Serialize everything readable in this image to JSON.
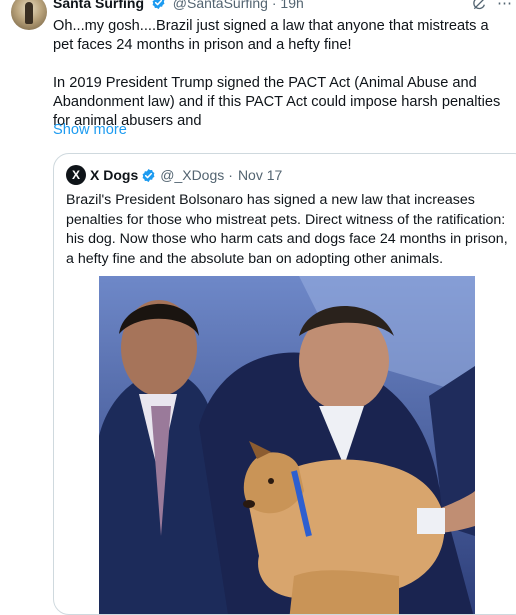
{
  "tweet": {
    "author_name": "Santa Surfing",
    "handle": "@SantaSurfing",
    "separator": "·",
    "time": "19h",
    "paragraph1": "Oh...my gosh....Brazil just signed a law that anyone that mistreats a pet faces 24 months in prison and a hefty fine!",
    "paragraph2": "In 2019 President Trump signed the PACT Act (Animal Abuse and Abandonment law) and if this PACT Act could impose harsh penalties for animal abusers and",
    "show_more": "Show more",
    "icons": [
      "grok-icon",
      "more-icon"
    ]
  },
  "quote": {
    "avatar_letter": "X",
    "author_name": "X Dogs",
    "handle": "@_XDogs",
    "separator": "·",
    "date": "Nov 17",
    "text": "Brazil's President Bolsonaro has signed a new law that increases penalties for those who mistreat pets. Direct witness of the ratification: his dog. Now those who harm cats and dogs face 24 months in prison, a hefty fine and the absolute ban on adopting other animals."
  },
  "colors": {
    "accent": "#1d9bf0",
    "text": "#0f1419",
    "muted": "#536471",
    "border": "#cfd9de"
  }
}
